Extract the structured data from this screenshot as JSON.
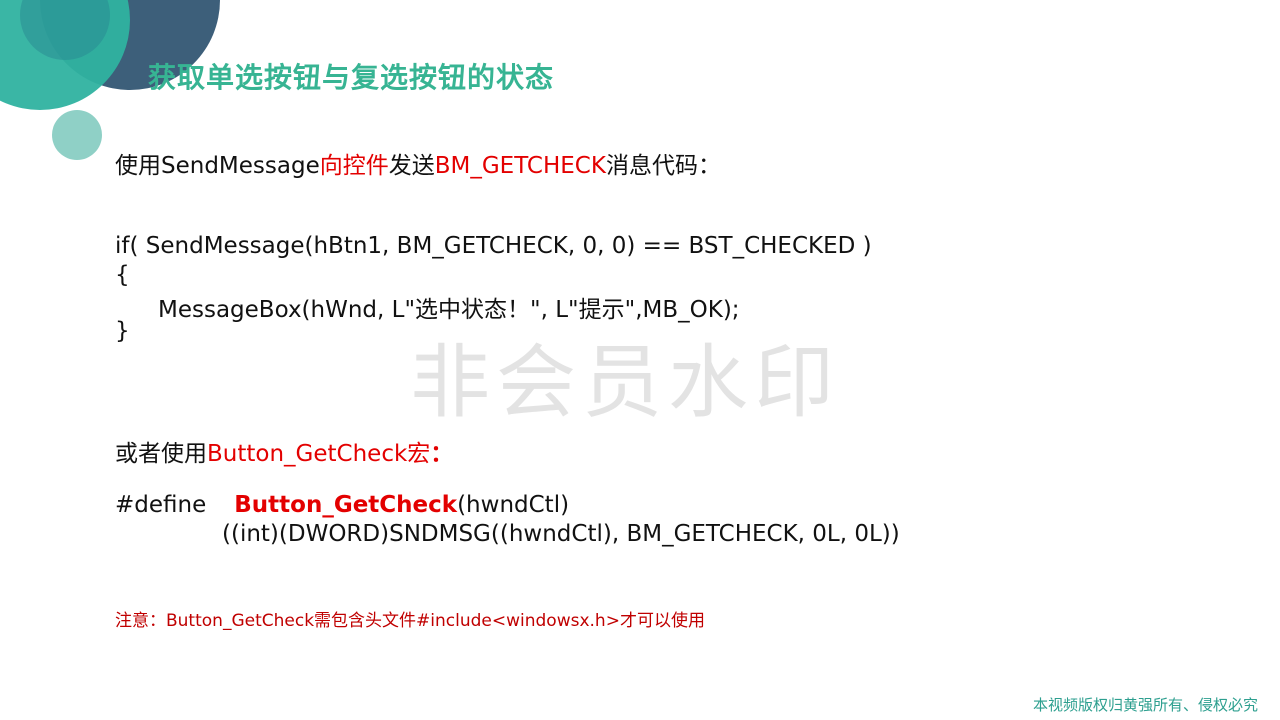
{
  "title": "获取单选按钮与复选按钮的状态",
  "intro": {
    "part1": "使用SendMessage",
    "part2": "向控件",
    "part3": "发送",
    "part4": "BM_GETCHECK",
    "part5": "消息代码："
  },
  "code1": {
    "line1": "if( SendMessage(hBtn1, BM_GETCHECK, 0, 0) == BST_CHECKED )",
    "line2": "{",
    "line3": "MessageBox(hWnd, L\"选中状态！\", L\"提示\",MB_OK);",
    "line4": "}"
  },
  "macro_intro": {
    "part1": "或者使用",
    "part2": "Button_GetCheck宏",
    "part3": "："
  },
  "code2": {
    "define": "#define",
    "macro_name": "Button_GetCheck",
    "params": "(hwndCtl)",
    "line2": "((int)(DWORD)SNDMSG((hwndCtl), BM_GETCHECK, 0L, 0L))"
  },
  "note": "注意：Button_GetCheck需包含头文件#include<windowsx.h>才可以使用",
  "watermark": "非会员水印",
  "copyright": "本视频版权归黄强所有、侵权必究",
  "colors": {
    "title": "#37b493",
    "highlight": "#e30000",
    "note": "#c00000",
    "deco_teal": "#2fb2a0",
    "deco_dark": "#3d5f7a",
    "deco_light": "#8fd0c6"
  }
}
